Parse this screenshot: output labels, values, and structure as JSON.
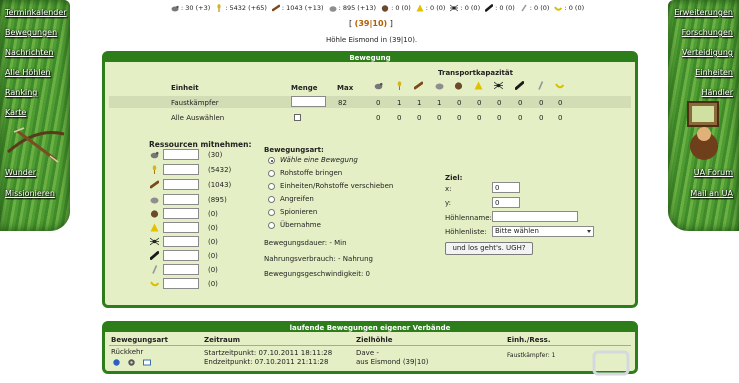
{
  "left_nav": [
    "Terminkalender",
    "Bewegungen",
    "Nachrichten",
    "Alle Höhlen",
    "Ranking",
    "Karte",
    "Wunder",
    "Missionieren"
  ],
  "right_nav": [
    "Erweiterungen",
    "Forschungen",
    "Verteidigung",
    "Einheiten",
    "Händler",
    "UA Forum",
    "Mail an UA"
  ],
  "resources_top": [
    {
      "icon": "boar-icon",
      "value": ": 30 (+3)"
    },
    {
      "icon": "wheat-icon",
      "value": ": 5432 (+65)"
    },
    {
      "icon": "wood-log-icon",
      "value": ": 1043 (+13)"
    },
    {
      "icon": "stone-icon",
      "value": ": 895 (+13)"
    },
    {
      "icon": "fur-icon",
      "value": ": 0 (0)"
    },
    {
      "icon": "sulfur-icon",
      "value": ": 0 (0)"
    },
    {
      "icon": "spider-icon",
      "value": ": 0 (0)"
    },
    {
      "icon": "dark-log-icon",
      "value": ": 0 (0)"
    },
    {
      "icon": "bone-icon",
      "value": ": 0 (0)"
    },
    {
      "icon": "banana-icon",
      "value": ": 0 (0)"
    }
  ],
  "coords": {
    "pre": "[ ",
    "value": "(39|10)",
    "post": " ]"
  },
  "cave_line": "Höhle Eismond in (39|10).",
  "movement": {
    "title": "Bewegung",
    "col_unit": "Einheit",
    "col_amount": "Menge",
    "col_max": "Max",
    "col_transport": "Transportkapazität",
    "unit_name": "Faustkämpfer",
    "unit_max": "82",
    "unit_caps": [
      "0",
      "1",
      "1",
      "1",
      "0",
      "0",
      "0",
      "0",
      "0",
      "0"
    ],
    "select_all": "Alle Auswählen",
    "select_all_caps": [
      "0",
      "0",
      "0",
      "0",
      "0",
      "0",
      "0",
      "0",
      "0",
      "0"
    ],
    "res_header": "Ressourcen mitnehmen:",
    "res_take": [
      "(30)",
      "(5432)",
      "(1043)",
      "(895)",
      "(0)",
      "(0)",
      "(0)",
      "(0)",
      "(0)",
      "(0)"
    ],
    "type_header": "Bewegungsart:",
    "types": [
      "Wähle eine Bewegung",
      "Rohstoffe bringen",
      "Einheiten/Rohstoffe verschieben",
      "Angreifen",
      "Spionieren",
      "Übernahme"
    ],
    "duration": "Bewegungsdauer:   - Min",
    "food": "Nahrungsverbrauch:     - Nahrung",
    "speed": "Bewegungsgeschwindigkeit:     0",
    "target_header": "Ziel:",
    "x_label": "x:",
    "x_value": "0",
    "y_label": "y:",
    "y_value": "0",
    "cavename_label": "Höhlenname:",
    "cavelist_label": "Höhlenliste:",
    "cavelist_value": "Bitte wählen",
    "submit": "und los geht's. UGH?"
  },
  "ongoing": {
    "title": "laufende Bewegungen eigener Verbände",
    "col_type": "Bewegungsart",
    "col_time": "Zeitraum",
    "col_target": "Zielhöhle",
    "col_units": "Einh./Ress.",
    "type": "Rückkehr",
    "start": "Startzeitpunkt: 07.10.2011 18:11:28",
    "end": "Endzeitpunkt: 07.10.2011 21:11:28",
    "target_line1": "Dave -",
    "target_line2": "aus Eismond (39|10)",
    "units": "Faustkämpfer: 1"
  },
  "colors": {
    "panel_border": "#2e7d1b",
    "panel_bg": "#e5efc5",
    "accent": "#b25d00"
  }
}
